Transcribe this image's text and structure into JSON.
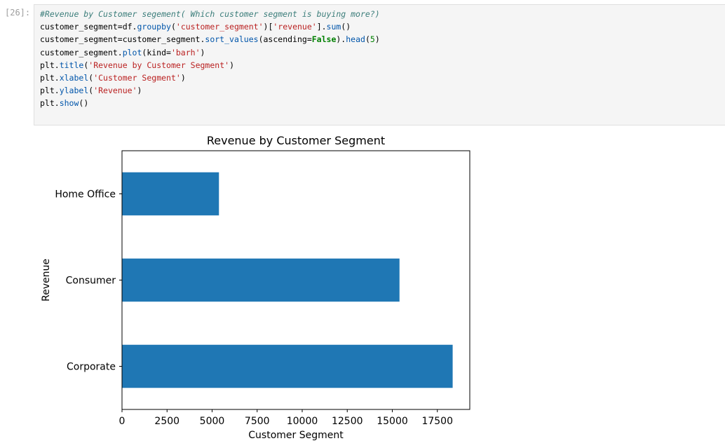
{
  "cell": {
    "prompt": "[26]:",
    "code_lines": [
      {
        "parts": [
          {
            "t": "#Revenue by Customer segement( Which customer segment is buying more?)",
            "c": "c-comment"
          }
        ]
      },
      {
        "parts": [
          {
            "t": "customer_segment=df.",
            "c": ""
          },
          {
            "t": "groupby",
            "c": "c-attr"
          },
          {
            "t": "(",
            "c": ""
          },
          {
            "t": "'customer_segment'",
            "c": "c-str"
          },
          {
            "t": ")[",
            "c": ""
          },
          {
            "t": "'revenue'",
            "c": "c-str"
          },
          {
            "t": "].",
            "c": ""
          },
          {
            "t": "sum",
            "c": "c-attr"
          },
          {
            "t": "()",
            "c": ""
          }
        ]
      },
      {
        "parts": [
          {
            "t": "customer_segment=customer_segment.",
            "c": ""
          },
          {
            "t": "sort_values",
            "c": "c-attr"
          },
          {
            "t": "(ascending=",
            "c": ""
          },
          {
            "t": "False",
            "c": "c-kw"
          },
          {
            "t": ").",
            "c": ""
          },
          {
            "t": "head",
            "c": "c-attr"
          },
          {
            "t": "(",
            "c": ""
          },
          {
            "t": "5",
            "c": "c-num"
          },
          {
            "t": ")",
            "c": ""
          }
        ]
      },
      {
        "parts": [
          {
            "t": "customer_segment.",
            "c": ""
          },
          {
            "t": "plot",
            "c": "c-attr"
          },
          {
            "t": "(kind=",
            "c": ""
          },
          {
            "t": "'barh'",
            "c": "c-str"
          },
          {
            "t": ")",
            "c": ""
          }
        ]
      },
      {
        "parts": [
          {
            "t": "plt.",
            "c": ""
          },
          {
            "t": "title",
            "c": "c-attr"
          },
          {
            "t": "(",
            "c": ""
          },
          {
            "t": "'Revenue by Customer Segment'",
            "c": "c-str"
          },
          {
            "t": ")",
            "c": ""
          }
        ]
      },
      {
        "parts": [
          {
            "t": "plt.",
            "c": ""
          },
          {
            "t": "xlabel",
            "c": "c-attr"
          },
          {
            "t": "(",
            "c": ""
          },
          {
            "t": "'Customer Segment'",
            "c": "c-str"
          },
          {
            "t": ")",
            "c": ""
          }
        ]
      },
      {
        "parts": [
          {
            "t": "plt.",
            "c": ""
          },
          {
            "t": "ylabel",
            "c": "c-attr"
          },
          {
            "t": "(",
            "c": ""
          },
          {
            "t": "'Revenue'",
            "c": "c-str"
          },
          {
            "t": ")",
            "c": ""
          }
        ]
      },
      {
        "parts": [
          {
            "t": "plt.",
            "c": ""
          },
          {
            "t": "show",
            "c": "c-attr"
          },
          {
            "t": "()",
            "c": ""
          }
        ]
      }
    ]
  },
  "chart_data": {
    "type": "bar",
    "orientation": "horizontal",
    "title": "Revenue by Customer Segment",
    "xlabel": "Customer Segment",
    "ylabel": "Revenue",
    "categories": [
      "Corporate",
      "Consumer",
      "Home Office"
    ],
    "values": [
      18350,
      15400,
      5380
    ],
    "xlim": [
      0,
      19300
    ],
    "xticks": [
      0,
      2500,
      5000,
      7500,
      10000,
      12500,
      15000,
      17500
    ],
    "bar_color": "#1f77b4",
    "grid": false,
    "legend": "none"
  }
}
